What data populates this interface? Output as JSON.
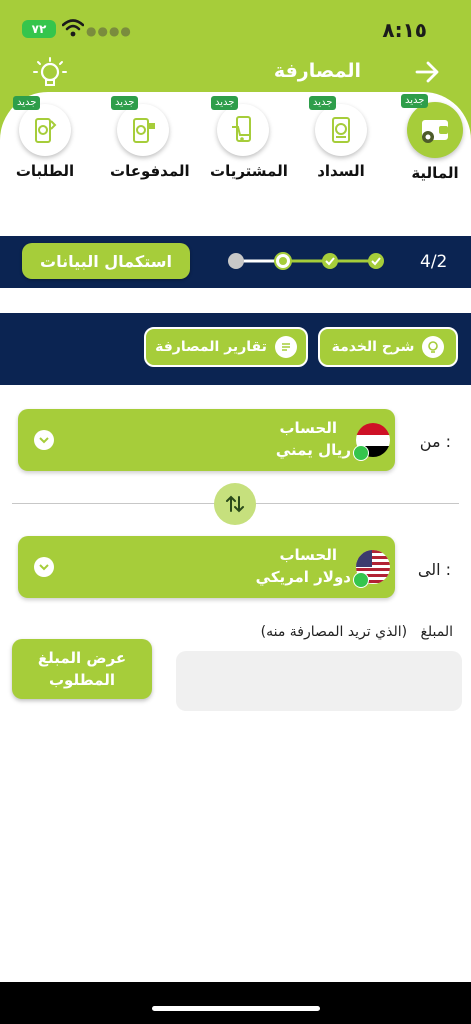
{
  "status": {
    "time": "٨:١٥",
    "battery": "٧٢"
  },
  "header": {
    "title": "المصارفة"
  },
  "categories": [
    {
      "label": "المالية",
      "badge": "جديد",
      "icon": "wallet-gear-icon"
    },
    {
      "label": "السداد",
      "badge": "جديد",
      "icon": "bill-pay-icon"
    },
    {
      "label": "المشتريات",
      "badge": "جديد",
      "icon": "phone-shopping-icon"
    },
    {
      "label": "المدفوعات",
      "badge": "جديد",
      "icon": "phone-payment-icon"
    },
    {
      "label": "الطلبات",
      "badge": "جديد",
      "icon": "phone-requests-icon"
    }
  ],
  "progress": {
    "button": "استكمال البيانات",
    "step_text": "4/2"
  },
  "services": {
    "explain": "شرح الخدمة",
    "reports": "تقارير المصارفة"
  },
  "from": {
    "side_label": "من :",
    "title": "الحساب",
    "currency": "ريال يمني"
  },
  "to": {
    "side_label": "الى :",
    "title": "الحساب",
    "currency": "دولار امريكي"
  },
  "amount": {
    "label": "المبلغ",
    "hint": "(الذي تريد المصارفة منه)",
    "show_button": "عرض المبلغ المطلوب"
  },
  "colors": {
    "accent": "#a6cd3a",
    "navy": "#0b2452",
    "badge": "#2e9e4a"
  }
}
